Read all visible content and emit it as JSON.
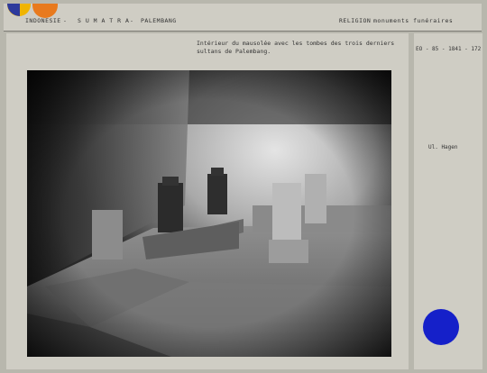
{
  "header": {
    "country": "INDONESIE",
    "sep1": "-",
    "island": "S U M A T R A",
    "sep2": "-",
    "city": "PALEMBANG",
    "category": "RELIGION",
    "subcategory": "monuments funéraires"
  },
  "caption": "Intérieur du mausolée avec les tombes des trois derniers sultans de Palembang.",
  "side": {
    "code": "EO - 85 - 1841 - 172",
    "author": "Ul. Hagen"
  },
  "colors": {
    "card_bg": "#b8b7ad",
    "panel_bg": "#cfcdc4",
    "accent_yellow": "#f0b400",
    "accent_orange": "#e87a1e",
    "accent_blue": "#1520c9"
  }
}
